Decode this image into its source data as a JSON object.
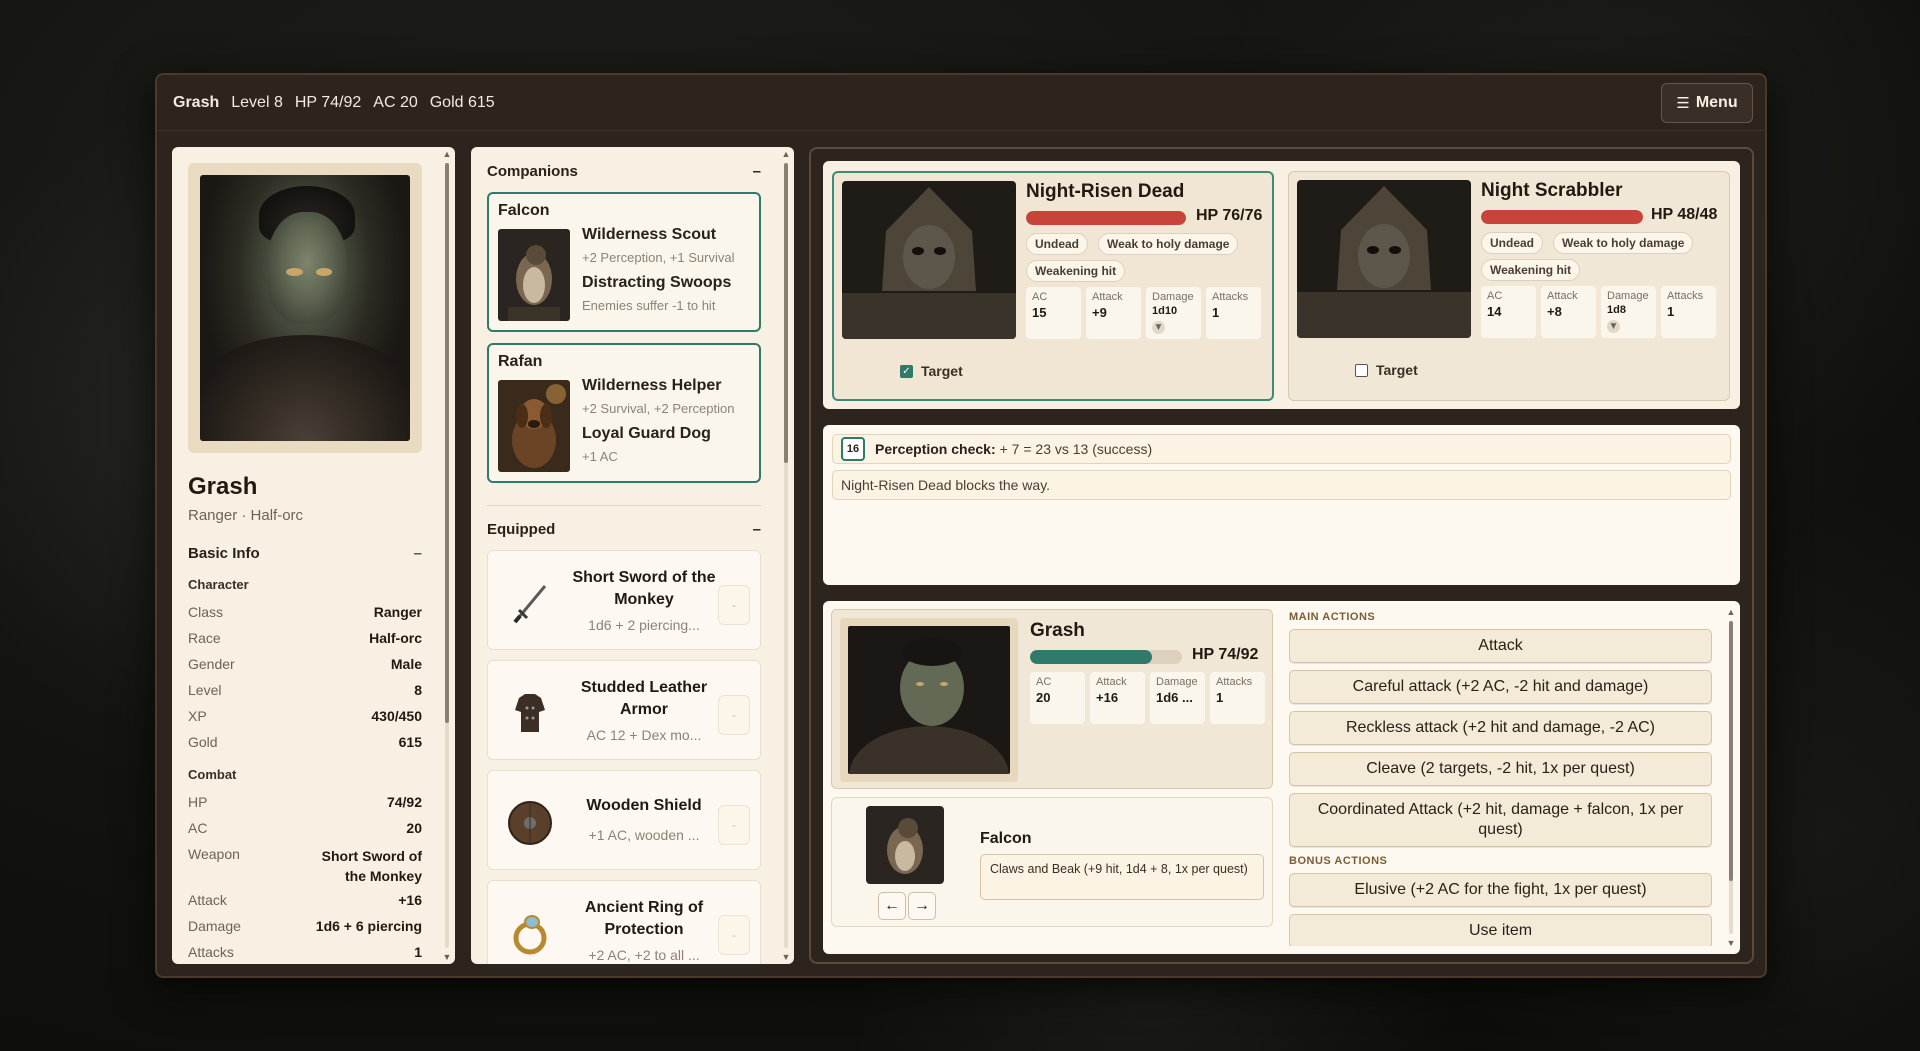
{
  "topbar": {
    "name": "Grash",
    "level": "Level 8",
    "hp": "HP 74/92",
    "ac": "AC 20",
    "gold": "Gold 615",
    "menu_label": "Menu",
    "menu_icon": "hamburger-icon"
  },
  "character": {
    "name": "Grash",
    "subtitle": "Ranger · Half-orc",
    "basic_info_title": "Basic Info",
    "character_title": "Character",
    "combat_title": "Combat",
    "collapse": "–",
    "fields": [
      {
        "k": "Class",
        "v": "Ranger"
      },
      {
        "k": "Race",
        "v": "Half-orc"
      },
      {
        "k": "Gender",
        "v": "Male"
      },
      {
        "k": "Level",
        "v": "8"
      },
      {
        "k": "XP",
        "v": "430/450"
      },
      {
        "k": "Gold",
        "v": "615"
      }
    ],
    "combat": [
      {
        "k": "HP",
        "v": "74/92"
      },
      {
        "k": "AC",
        "v": "20"
      },
      {
        "k": "Weapon",
        "v": "Short Sword of the Monkey"
      },
      {
        "k": "Attack",
        "v": "+16"
      },
      {
        "k": "Damage",
        "v": "1d6 + 6 piercing"
      },
      {
        "k": "Attacks",
        "v": "1"
      }
    ]
  },
  "companions": {
    "title": "Companions",
    "collapse": "–",
    "items": [
      {
        "name": "Falcon",
        "trait1": "Wilderness Scout",
        "desc1": "+2 Perception, +1 Survival",
        "trait2": "Distracting Swoops",
        "desc2": "Enemies suffer -1 to hit"
      },
      {
        "name": "Rafan",
        "trait1": "Wilderness Helper",
        "desc1": "+2 Survival, +2 Perception",
        "trait2": "Loyal Guard Dog",
        "desc2": "+1 AC"
      }
    ]
  },
  "equipped": {
    "title": "Equipped",
    "collapse": "–",
    "items": [
      {
        "name": "Short Sword of the Monkey",
        "desc": "1d6 + 2 piercing...",
        "icon": "sword-icon",
        "btn": "-"
      },
      {
        "name": "Studded Leather Armor",
        "desc": "AC 12 + Dex mo...",
        "icon": "armor-icon",
        "btn": "-"
      },
      {
        "name": "Wooden Shield",
        "desc": "+1 AC, wooden ...",
        "icon": "shield-icon",
        "btn": "-"
      },
      {
        "name": "Ancient Ring of Protection",
        "desc": "+2 AC, +2 to all ...",
        "icon": "ring-icon",
        "btn": "-"
      }
    ]
  },
  "enemies": [
    {
      "name": "Night-Risen Dead",
      "hp": "HP 76/76",
      "hp_fraction": 1.0,
      "tags": [
        "Undead",
        "Weak to holy damage",
        "Weakening hit"
      ],
      "stats": {
        "ac_l": "AC",
        "ac": "15",
        "atk_l": "Attack",
        "atk": "+9",
        "dmg_l": "Damage",
        "dmg": "1d10",
        "n_l": "Attacks",
        "n": "1"
      },
      "target_label": "Target",
      "targeted": true
    },
    {
      "name": "Night Scrabbler",
      "hp": "HP 48/48",
      "hp_fraction": 1.0,
      "tags": [
        "Undead",
        "Weak to holy damage",
        "Weakening hit"
      ],
      "stats": {
        "ac_l": "AC",
        "ac": "14",
        "atk_l": "Attack",
        "atk": "+8",
        "dmg_l": "Damage",
        "dmg": "1d8",
        "n_l": "Attacks",
        "n": "1"
      },
      "target_label": "Target",
      "targeted": false
    }
  ],
  "log": {
    "die_value": "16",
    "check_label": "Perception check:",
    "check_text": "+ 7 = 23 vs 13 (success)",
    "line2": "Night-Risen Dead blocks the way."
  },
  "player": {
    "name": "Grash",
    "hp": "HP 74/92",
    "hp_fraction": 0.804,
    "stats": {
      "ac_l": "AC",
      "ac": "20",
      "atk_l": "Attack",
      "atk": "+16",
      "dmg_l": "Damage",
      "dmg": "1d6 ...",
      "n_l": "Attacks",
      "n": "1"
    }
  },
  "companion_active": {
    "name": "Falcon",
    "attack": "Claws and Beak (+9 hit, 1d4 + 8, 1x per quest)",
    "prev": "←",
    "next": "→"
  },
  "actions": {
    "main_title": "MAIN ACTIONS",
    "main": [
      "Attack",
      "Careful attack (+2 AC, -2 hit and damage)",
      "Reckless attack (+2 hit and damage, -2 AC)",
      "Cleave (2 targets, -2 hit, 1x per quest)",
      "Coordinated Attack (+2 hit, damage + falcon, 1x per quest)"
    ],
    "bonus_title": "BONUS ACTIONS",
    "bonus": [
      "Elusive (+2 AC for the fight, 1x per quest)",
      "Use item"
    ]
  },
  "colors": {
    "accent": "#2f7a6b",
    "enemy_hp": "#c8443b",
    "player_hp": "#2f7a6b"
  }
}
